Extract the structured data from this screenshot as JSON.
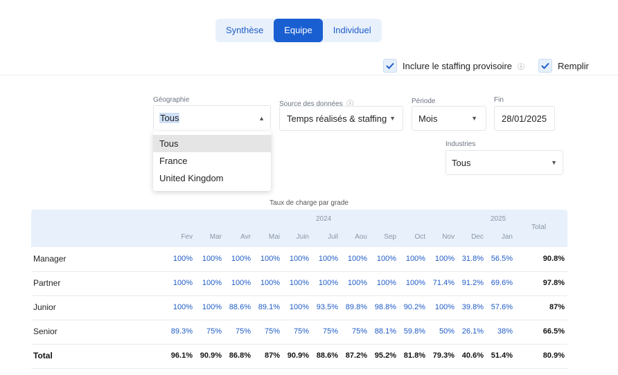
{
  "tabs": [
    {
      "label": "Synthèse",
      "active": false
    },
    {
      "label": "Equipe",
      "active": true
    },
    {
      "label": "Individuel",
      "active": false
    }
  ],
  "options": {
    "staffing_provisoire": {
      "label": "Inclure le staffing provisoire",
      "checked": true,
      "info_icon": "info-icon"
    },
    "remplir": {
      "label": "Remplir",
      "checked": true
    }
  },
  "filters": {
    "geographie": {
      "label": "Géographie",
      "value": "Tous",
      "open": true
    },
    "source": {
      "label": "Source des données",
      "value": "Temps réalisés & staffing",
      "info_icon": "info-icon"
    },
    "periode": {
      "label": "Période",
      "value": "Mois"
    },
    "fin": {
      "label": "Fin",
      "value": "28/01/2025"
    },
    "industries": {
      "label": "Industries",
      "value": "Tous"
    }
  },
  "geo_options": [
    "Tous",
    "France",
    "United Kingdom"
  ],
  "table": {
    "caption": "Taux de charge par grade",
    "year_2024": "2024",
    "year_2025": "2025",
    "total_header": "Total",
    "months": [
      "Fev",
      "Mar",
      "Avr",
      "Mai",
      "Juin",
      "Juil",
      "Aou",
      "Sep",
      "Oct",
      "Nov",
      "Dec",
      "Jan"
    ],
    "rows": [
      {
        "label": "Manager",
        "values": [
          "100%",
          "100%",
          "100%",
          "100%",
          "100%",
          "100%",
          "100%",
          "100%",
          "100%",
          "100%",
          "31.8%",
          "56.5%"
        ],
        "total": "90.8%"
      },
      {
        "label": "Partner",
        "values": [
          "100%",
          "100%",
          "100%",
          "100%",
          "100%",
          "100%",
          "100%",
          "100%",
          "100%",
          "71.4%",
          "91.2%",
          "69.6%"
        ],
        "total": "97.8%"
      },
      {
        "label": "Junior",
        "values": [
          "100%",
          "100%",
          "88.6%",
          "89.1%",
          "100%",
          "93.5%",
          "89.8%",
          "98.8%",
          "90.2%",
          "100%",
          "39.8%",
          "57.6%"
        ],
        "total": "87%"
      },
      {
        "label": "Senior",
        "values": [
          "89.3%",
          "75%",
          "75%",
          "75%",
          "75%",
          "75%",
          "75%",
          "88.1%",
          "59.8%",
          "50%",
          "26.1%",
          "38%"
        ],
        "total": "66.5%"
      },
      {
        "label": "Total",
        "values": [
          "96.1%",
          "90.9%",
          "86.8%",
          "87%",
          "90.9%",
          "88.6%",
          "87.2%",
          "95.2%",
          "81.8%",
          "79.3%",
          "40.6%",
          "51.4%"
        ],
        "total": "80.9%",
        "is_total": true
      }
    ]
  },
  "colors": {
    "accent": "#1a5fd1",
    "link": "#1e5bc6",
    "header_bg": "#e7f0fb"
  }
}
